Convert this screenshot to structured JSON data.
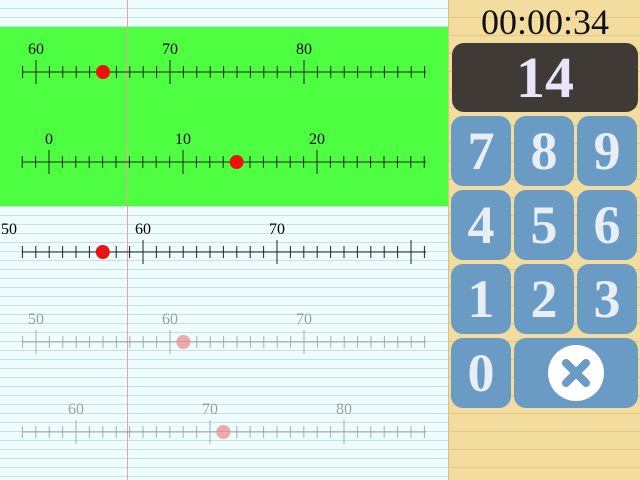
{
  "timer": "00:00:34",
  "answer": "14",
  "keypad": {
    "keys": [
      "7",
      "8",
      "9",
      "4",
      "5",
      "6",
      "1",
      "2",
      "3",
      "0"
    ],
    "clear_icon": "clear-x-icon"
  },
  "colors": {
    "active_band": "#4dff40",
    "marker": "#ee1111",
    "key": "#6a9bc5",
    "answer_box": "#3f3a36"
  },
  "rulers": [
    {
      "labels": [
        "60",
        "70",
        "80"
      ],
      "marker_value": 65,
      "state": "active"
    },
    {
      "labels": [
        "0",
        "10",
        "20"
      ],
      "marker_value": 14,
      "state": "active"
    },
    {
      "labels": [
        "50",
        "60",
        "70"
      ],
      "marker_value": 57,
      "state": "normal"
    },
    {
      "labels": [
        "50",
        "60",
        "70"
      ],
      "marker_value": 61,
      "state": "faded"
    },
    {
      "labels": [
        "60",
        "70",
        "80"
      ],
      "marker_value": 71,
      "state": "faded"
    }
  ]
}
